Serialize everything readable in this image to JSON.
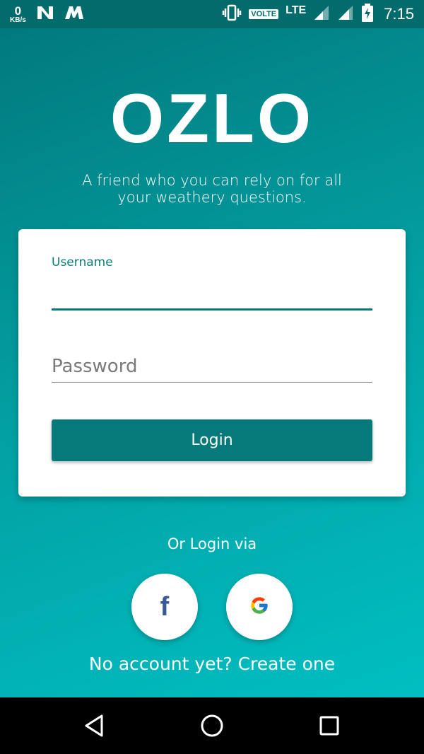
{
  "status_bar": {
    "speed_value": "0",
    "speed_unit": "KB/s",
    "network_label": "VOLTE",
    "lte_label": "LTE",
    "time": "7:15"
  },
  "app": {
    "logo_text": "OZLO",
    "tagline": "A friend who you can rely on for all your weathery questions."
  },
  "login_form": {
    "username_label": "Username",
    "username_value": "",
    "password_placeholder": "Password",
    "login_button_label": "Login"
  },
  "social": {
    "or_login_via": "Or Login via",
    "facebook_glyph": "f",
    "google_icon": "google-icon"
  },
  "signup_link": "No account yet? Create one",
  "colors": {
    "primary": "#067a7a",
    "gradient_top": "#01777a",
    "gradient_bottom": "#00c3c6",
    "facebook": "#3b5998"
  }
}
